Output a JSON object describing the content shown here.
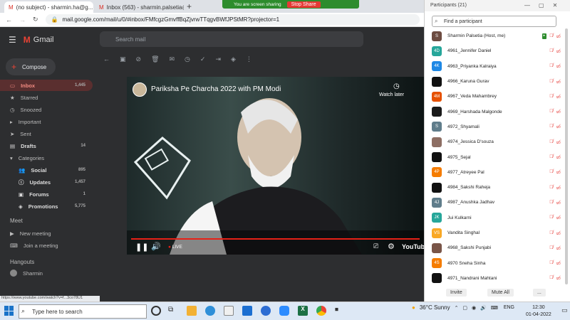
{
  "browser": {
    "tabs": [
      {
        "label": "(no subject) - sharmin.ha@g...",
        "close": "×"
      },
      {
        "label": "Inbox (563) - sharmin.palsetia@...",
        "close": "×"
      }
    ],
    "new_tab": "+",
    "url": "mail.google.com/mail/u/0/#inbox/FMfcgzGmvffBqZjvrwTTqgvBWfJPStMR?projector=1",
    "status_url": "https://www.youtube.com/watch?v=f...3co78U1"
  },
  "screen_share": {
    "label": "You are screen sharing",
    "stop": "Stop Share"
  },
  "gmail": {
    "logo": "Gmail",
    "search_placeholder": "Search mail",
    "compose": "Compose",
    "nav": [
      {
        "label": "Inbox",
        "count": "1,445"
      },
      {
        "label": "Starred",
        "count": ""
      },
      {
        "label": "Snoozed",
        "count": ""
      },
      {
        "label": "Important",
        "count": ""
      },
      {
        "label": "Sent",
        "count": ""
      },
      {
        "label": "Drafts",
        "count": "14"
      },
      {
        "label": "Categories",
        "count": ""
      },
      {
        "label": "Social",
        "count": "895"
      },
      {
        "label": "Updates",
        "count": "1,457"
      },
      {
        "label": "Forums",
        "count": "1"
      },
      {
        "label": "Promotions",
        "count": "5,775"
      }
    ],
    "meet": {
      "title": "Meet",
      "items": [
        "New meeting",
        "Join a meeting"
      ]
    },
    "hangouts": {
      "title": "Hangouts",
      "user": "Sharmin"
    }
  },
  "video": {
    "title": "Pariksha Pe Charcha 2022 with PM Modi",
    "watch_later": "Watch later",
    "live": "LIVE",
    "logo": "YouTube"
  },
  "participants": {
    "title": "Participants (21)",
    "find_placeholder": "Find a participant",
    "list": [
      {
        "initials": "S",
        "name": "Sharmin Palsetia (Host, me)",
        "color": "#6d4c41"
      },
      {
        "initials": "4D",
        "name": "4961_Jennifer Daniel",
        "color": "#26a69a"
      },
      {
        "initials": "4K",
        "name": "4963_Priyanka Kalraiya",
        "color": "#1e88e5"
      },
      {
        "initials": "",
        "name": "4966_Karuna Gurav",
        "color": "#111111"
      },
      {
        "initials": "4M",
        "name": "4967_Veda Mahambrey",
        "color": "#e65100"
      },
      {
        "initials": "",
        "name": "4969_Harshada Malgonde",
        "color": "#1a1a1a"
      },
      {
        "initials": "S",
        "name": "4972_Shyamali",
        "color": "#607d8b"
      },
      {
        "initials": "",
        "name": "4974_Jessica D'souza",
        "color": "#8d6e63"
      },
      {
        "initials": "",
        "name": "4975_Sejal",
        "color": "#111111"
      },
      {
        "initials": "4P",
        "name": "4977_Atreyee Pal",
        "color": "#f57c00"
      },
      {
        "initials": "",
        "name": "4984_Sakshi Raheja",
        "color": "#111111"
      },
      {
        "initials": "4J",
        "name": "4987_Anushka Jadhav",
        "color": "#607d8b"
      },
      {
        "initials": "JK",
        "name": "Jui Kulkarni",
        "color": "#26a69a"
      },
      {
        "initials": "VS",
        "name": "Vandita Singhal",
        "color": "#f9a825"
      },
      {
        "initials": "",
        "name": "4968_Sakshi Punjabi",
        "color": "#795548"
      },
      {
        "initials": "4S",
        "name": "4970 Sneha Sinha",
        "color": "#f57c00"
      },
      {
        "initials": "",
        "name": "4971_Nandrani Mahtani",
        "color": "#111111"
      }
    ],
    "invite": "Invite",
    "mute_all": "Mute All",
    "more": "..."
  },
  "taskbar": {
    "search_placeholder": "Type here to search",
    "weather": "36°C  Sunny",
    "lang": "ENG",
    "time": "12:30",
    "date": "01-04-2022"
  }
}
